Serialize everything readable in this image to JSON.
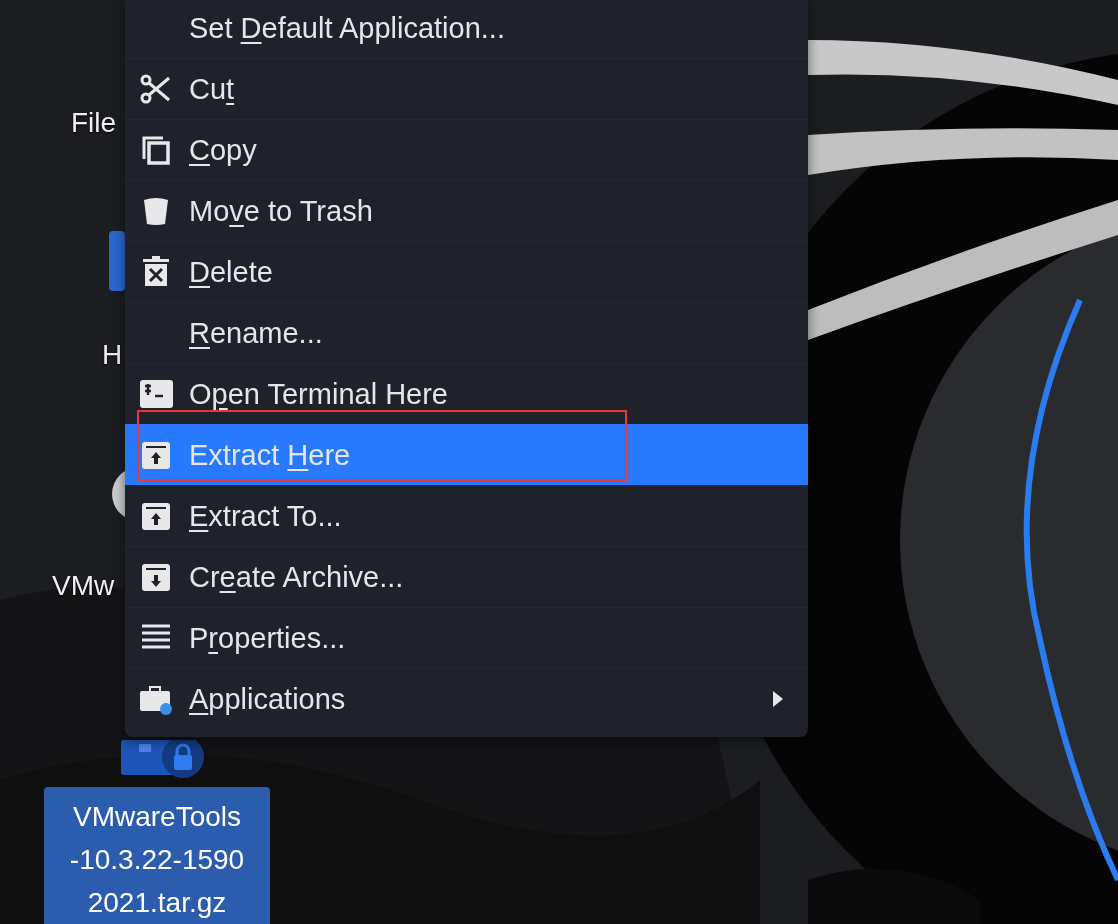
{
  "desktop_icons": [
    {
      "label": "File",
      "kind": "partial"
    },
    {
      "label": "H",
      "kind": "folder"
    },
    {
      "label": "VMw",
      "kind": "disc"
    },
    {
      "label_lines": [
        "VMwareTools",
        "-10.3.22-1590",
        "2021.tar.gz"
      ],
      "kind": "archive",
      "selected": true
    }
  ],
  "context_menu": {
    "items": [
      {
        "label": {
          "pre": "Set ",
          "key": "D",
          "post": "efault Application..."
        },
        "kind": "plain",
        "selected": false
      },
      {
        "label": {
          "pre": "Cu",
          "key": "t"
        },
        "kind": "scissors",
        "selected": false
      },
      {
        "label": {
          "key": "C",
          "post": "opy"
        },
        "kind": "copy",
        "selected": false
      },
      {
        "label": {
          "pre": "Mo",
          "key": "v",
          "post": "e to Trash"
        },
        "kind": "trash",
        "selected": false
      },
      {
        "label": {
          "key": "D",
          "post": "elete"
        },
        "kind": "delete",
        "selected": false
      },
      {
        "label": {
          "key": "R",
          "post": "ename..."
        },
        "kind": "plain",
        "selected": false
      },
      {
        "label": {
          "pre": "O",
          "key": "p",
          "post": "en Terminal Here"
        },
        "kind": "terminal",
        "selected": false
      },
      {
        "label": {
          "pre": "Extract ",
          "key": "H",
          "post": "ere"
        },
        "kind": "extract",
        "selected": true,
        "annotated": true
      },
      {
        "label": {
          "key": "E",
          "post": "xtract To..."
        },
        "kind": "extract",
        "selected": false
      },
      {
        "label": {
          "pre": "Cr",
          "key": "e",
          "post": "ate Archive..."
        },
        "kind": "archive",
        "selected": false
      },
      {
        "label": {
          "pre": "P",
          "key": "r",
          "post": "operties..."
        },
        "kind": "properties",
        "selected": false
      },
      {
        "label": {
          "key": "A",
          "post": "pplications"
        },
        "kind": "applications",
        "selected": false,
        "submenu": true
      }
    ]
  }
}
